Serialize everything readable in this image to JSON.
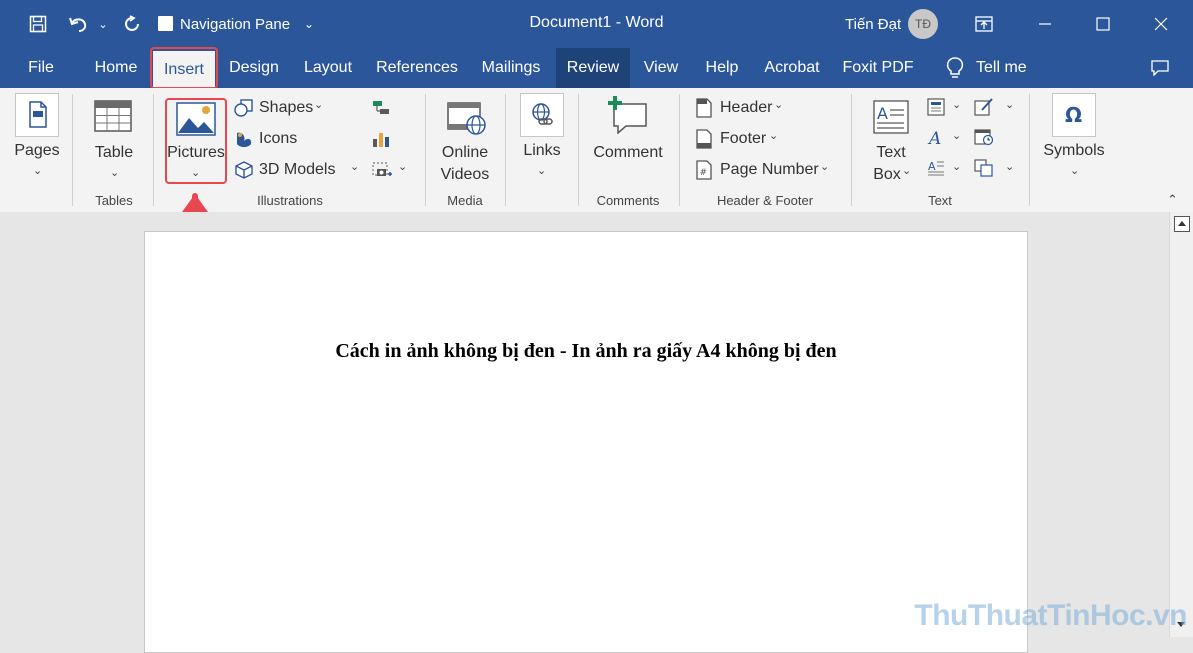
{
  "titlebar": {
    "nav_pane_label": "Navigation Pane",
    "doc_title": "Document1  -  Word",
    "user_name": "Tiến Đạt",
    "user_initials": "TĐ"
  },
  "tabs": [
    {
      "label": "File"
    },
    {
      "label": "Home"
    },
    {
      "label": "Insert"
    },
    {
      "label": "Design"
    },
    {
      "label": "Layout"
    },
    {
      "label": "References"
    },
    {
      "label": "Mailings"
    },
    {
      "label": "Review"
    },
    {
      "label": "View"
    },
    {
      "label": "Help"
    },
    {
      "label": "Acrobat"
    },
    {
      "label": "Foxit PDF"
    }
  ],
  "tell_me": "Tell me",
  "ribbon": {
    "pages": "Pages",
    "table": "Table",
    "tables_group": "Tables",
    "pictures": "Pictures",
    "shapes": "Shapes",
    "icons": "Icons",
    "models": "3D Models",
    "illustrations_group": "Illustrations",
    "online_videos_1": "Online",
    "online_videos_2": "Videos",
    "media_group": "Media",
    "links": "Links",
    "comment": "Comment",
    "comments_group": "Comments",
    "header": "Header",
    "footer": "Footer",
    "page_number": "Page Number",
    "hf_group": "Header & Footer",
    "text_box_1": "Text",
    "text_box_2": "Box",
    "text_group": "Text",
    "symbols": "Symbols"
  },
  "document": {
    "title": "Cách in ảnh không bị đen - In ảnh ra giấy A4 không bị đen"
  },
  "watermark": "ThuThuatTinHoc.vn",
  "colors": {
    "ribbon_blue": "#2b579a",
    "highlight_red": "#e8474f",
    "review_tab": "#1e4379"
  }
}
